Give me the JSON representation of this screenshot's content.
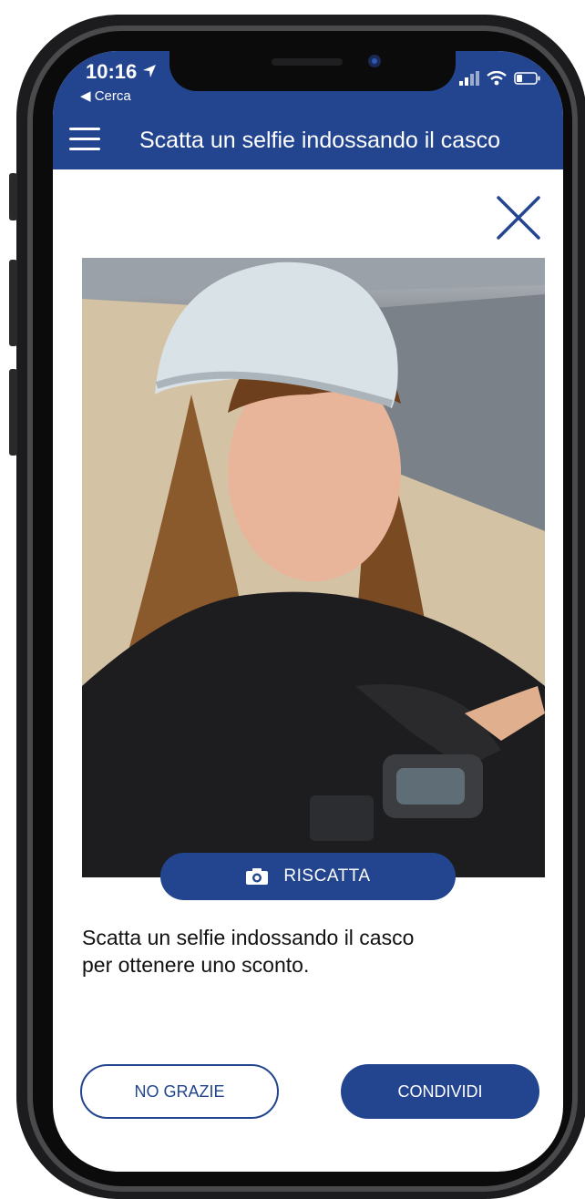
{
  "status": {
    "time": "10:16",
    "back_label": "◀ Cerca"
  },
  "header": {
    "title": "Scatta un selfie indossando il casco"
  },
  "photo": {
    "retake_label": "RISCATTA"
  },
  "description": {
    "line1": "Scatta un selfie indossando il casco",
    "line2": "per ottenere uno sconto."
  },
  "actions": {
    "decline_label": "NO GRAZIE",
    "share_label": "CONDIVIDI"
  },
  "colors": {
    "brand": "#234590",
    "background": "#ffffff",
    "text": "#111111"
  },
  "icons": [
    "location-arrow-icon",
    "signal-icon",
    "wifi-icon",
    "battery-icon",
    "menu-icon",
    "close-icon",
    "camera-icon"
  ]
}
